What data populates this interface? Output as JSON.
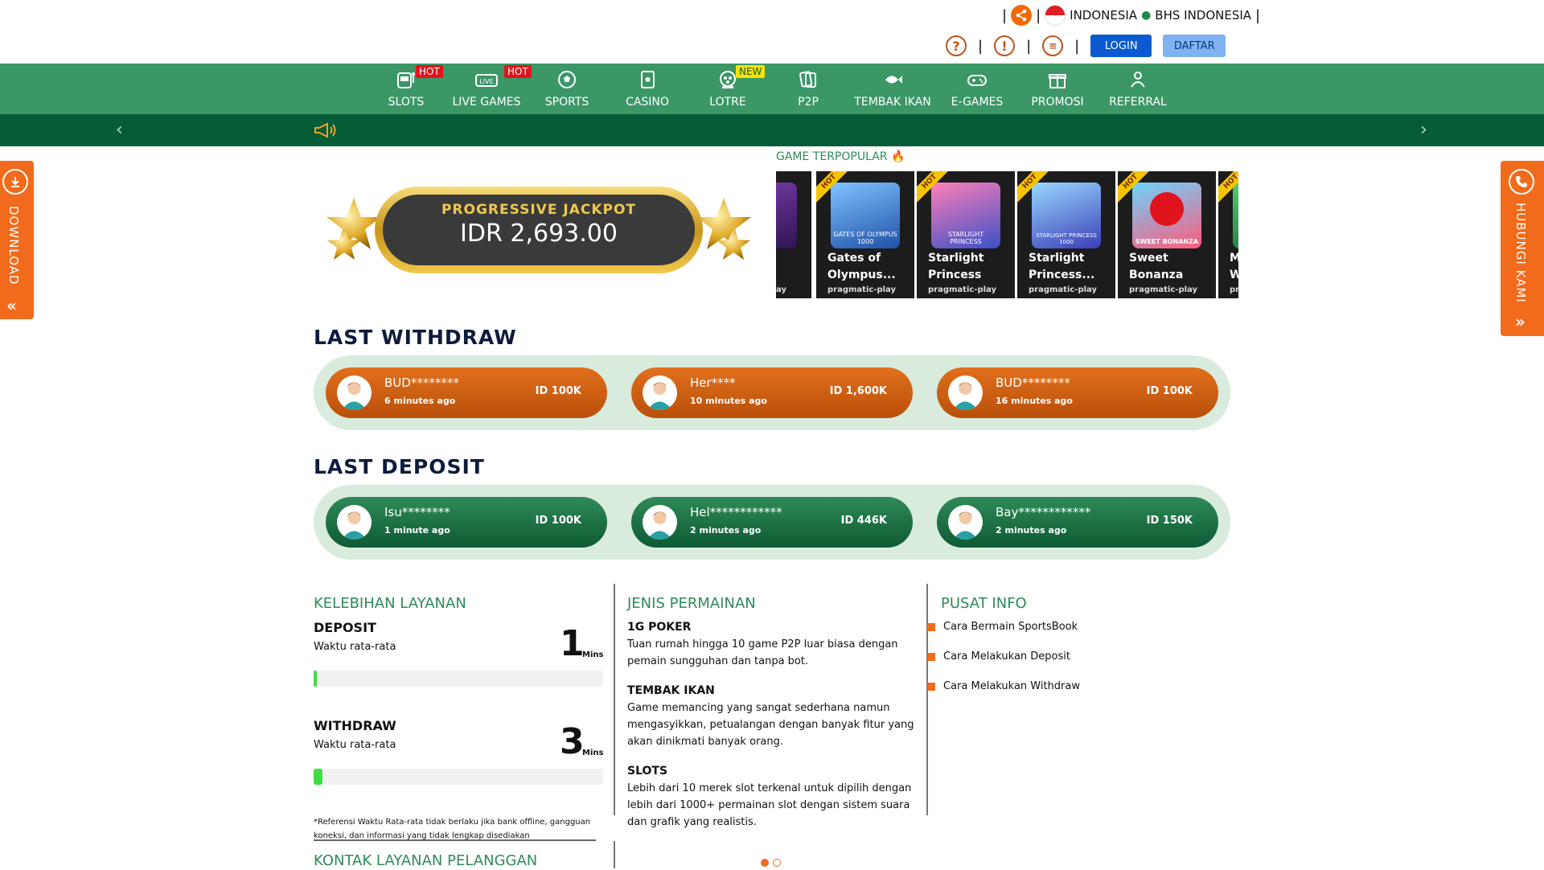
{
  "header": {
    "language_label": "INDONESIA",
    "language_sub": "BHS INDONESIA",
    "login_label": "LOGIN",
    "register_label": "DAFTAR",
    "icons": [
      "help-icon",
      "alert-icon",
      "chat-icon",
      "share-icon"
    ]
  },
  "nav": {
    "items": [
      {
        "label": "SLOTS",
        "badge": "HOT",
        "icon": "slot-machine-icon"
      },
      {
        "label": "LIVE GAMES",
        "badge": "HOT",
        "icon": "live-icon"
      },
      {
        "label": "SPORTS",
        "badge": "",
        "icon": "soccer-ball-icon"
      },
      {
        "label": "CASINO",
        "badge": "",
        "icon": "casino-card-icon"
      },
      {
        "label": "LOTRE",
        "badge": "NEW",
        "icon": "lottery-icon"
      },
      {
        "label": "P2P",
        "badge": "",
        "icon": "p2p-cards-icon"
      },
      {
        "label": "TEMBAK IKAN",
        "badge": "",
        "icon": "fish-icon"
      },
      {
        "label": "E-GAMES",
        "badge": "",
        "icon": "gamepad-icon"
      },
      {
        "label": "PROMOSI",
        "badge": "",
        "icon": "gift-icon"
      },
      {
        "label": "REFERRAL",
        "badge": "",
        "icon": "referral-icon"
      }
    ]
  },
  "side": {
    "download_label": "DOWNLOAD",
    "contact_label": "HUBUNGI KAMI"
  },
  "jackpot": {
    "title": "PROGRESSIVE JACKPOT",
    "amount": "IDR 2,693.00"
  },
  "popular": {
    "title": "GAME TERPOPULAR",
    "partial_left": "ay",
    "games": [
      {
        "name_line1": "Gates of",
        "name_line2": "Olympus...",
        "provider": "pragmatic-play",
        "badge": "HOT",
        "thumb_text": "GATES OF OLYMPUS 1000"
      },
      {
        "name_line1": "Starlight",
        "name_line2": "Princess",
        "provider": "pragmatic-play",
        "badge": "HOT",
        "thumb_text": "STARLIGHT PRINCESS"
      },
      {
        "name_line1": "Starlight",
        "name_line2": "Princess...",
        "provider": "pragmatic-play",
        "badge": "HOT",
        "thumb_text": "STARLIGHT PRINCESS 1000"
      },
      {
        "name_line1": "Sweet",
        "name_line2": "Bonanza",
        "provider": "pragmatic-play",
        "badge": "HOT",
        "thumb_text": "SWEET BONANZA"
      }
    ],
    "partial_right": {
      "line1": "M",
      "line2": "W",
      "prov": "pr",
      "badge": "HOT"
    }
  },
  "withdraw": {
    "title": "LAST WITHDRAW",
    "items": [
      {
        "user": "BUD********",
        "time": "6 minutes ago",
        "amount": "ID 100K"
      },
      {
        "user": "Her****",
        "time": "10 minutes ago",
        "amount": "ID 1,600K"
      },
      {
        "user": "BUD********",
        "time": "16 minutes ago",
        "amount": "ID 100K"
      }
    ]
  },
  "deposit": {
    "title": "LAST DEPOSIT",
    "items": [
      {
        "user": "Isu********",
        "time": "1 minute ago",
        "amount": "ID 100K"
      },
      {
        "user": "Hel************",
        "time": "2 minutes ago",
        "amount": "ID 446K"
      },
      {
        "user": "Bay************",
        "time": "2 minutes ago",
        "amount": "ID 150K"
      }
    ]
  },
  "service": {
    "title": "KELEBIHAN LAYANAN",
    "stats": [
      {
        "label": "DEPOSIT",
        "sub": "Waktu rata-rata",
        "value": "1",
        "unit": "Mins",
        "progress": 0.01
      },
      {
        "label": "WITHDRAW",
        "sub": "Waktu rata-rata",
        "value": "3",
        "unit": "Mins",
        "progress": 0.03
      }
    ],
    "note": "*Referensi Waktu Rata-rata tidak berlaku jika bank offline, gangguan koneksi, dan informasi yang tidak lengkap disediakan",
    "contact_title": "KONTAK LAYANAN PELANGGAN"
  },
  "games_info": {
    "title": "JENIS PERMAINAN",
    "items": [
      {
        "name": "1G POKER",
        "desc": "Tuan rumah hingga 10 game P2P luar biasa dengan pemain sungguhan dan tanpa bot."
      },
      {
        "name": "TEMBAK IKAN",
        "desc": "Game memancing yang sangat sederhana namun mengasyikkan, petualangan dengan banyak fitur yang akan dinikmati banyak orang."
      },
      {
        "name": "SLOTS",
        "desc": "Lebih dari 10 merek slot terkenal untuk dipilih dengan lebih dari 1000+ permainan slot dengan sistem suara dan grafik yang realistis."
      }
    ]
  },
  "info_center": {
    "title": "PUSAT INFO",
    "links": [
      "Cara Bermain SportsBook",
      "Cara Melakukan Deposit",
      "Cara Melakukan Withdraw"
    ]
  },
  "carousel": {
    "active_index": 0,
    "count": 2
  },
  "colors": {
    "nav_green": "#3c9767",
    "dark_green": "#065c37",
    "accent_orange": "#f26a1b",
    "login_blue": "#0a5bd1",
    "heading_green": "#2e8b57"
  }
}
